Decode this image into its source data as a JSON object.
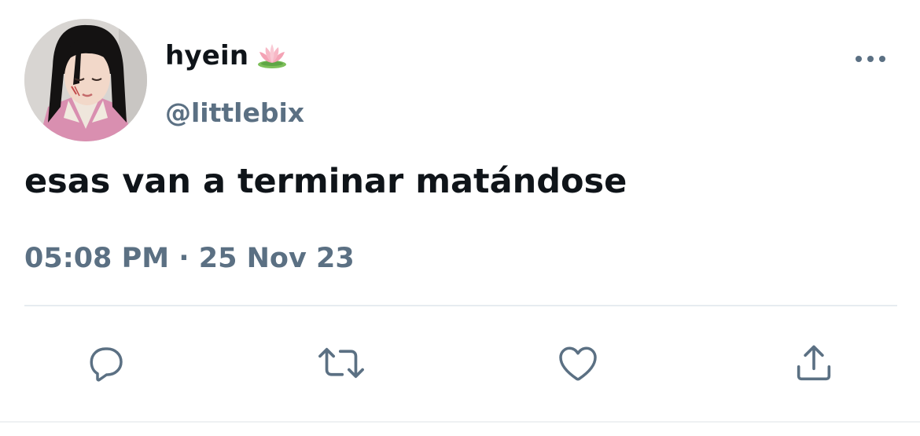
{
  "user": {
    "display_name": "hyein",
    "display_name_emoji": "lotus-icon",
    "handle": "@littlebix",
    "avatar": "profile-photo"
  },
  "tweet": {
    "text": "esas van a terminar matándose",
    "timestamp": "05:08 PM · 25 Nov 23"
  },
  "actions": {
    "more": "more-options-icon",
    "reply": "reply-icon",
    "retweet": "retweet-icon",
    "like": "like-icon",
    "share": "share-icon"
  },
  "colors": {
    "text_primary": "#0f1419",
    "text_secondary": "#5b7083",
    "divider": "#e6ecf0",
    "background": "#ffffff"
  }
}
